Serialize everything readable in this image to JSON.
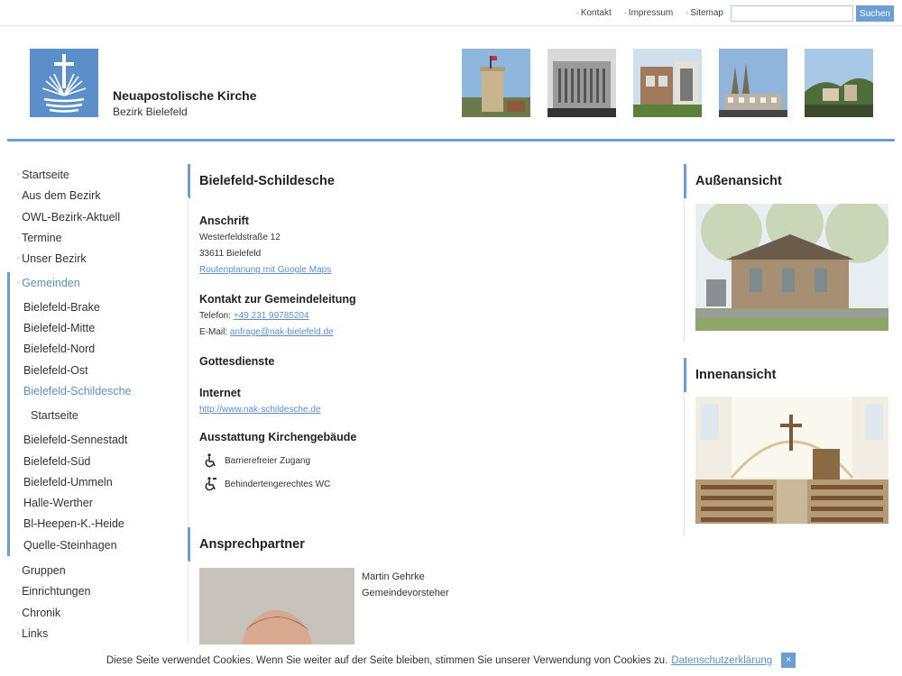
{
  "topbar": {
    "links": [
      "Kontakt",
      "Impressum",
      "Sitemap"
    ],
    "search_value": "",
    "search_button": "Suchen"
  },
  "header": {
    "title": "Neuapostolische Kirche",
    "subtitle": "Bezirk Bielefeld"
  },
  "sidebar": {
    "top_items": [
      "Startseite",
      "Aus dem Bezirk",
      "OWL-Bezirk-Aktuell",
      "Termine",
      "Unser Bezirk"
    ],
    "active_item": "Gemeinden",
    "sub_items_a": [
      "Bielefeld-Brake",
      "Bielefeld-Mitte",
      "Bielefeld-Nord",
      "Bielefeld-Ost"
    ],
    "sub_active": "Bielefeld-Schildesche",
    "subsub_item": "Startseite",
    "sub_items_b": [
      "Bielefeld-Sennestadt",
      "Bielefeld-Süd",
      "Bielefeld-Ummeln",
      "Halle-Werther",
      "Bl-Heepen-K.-Heide",
      "Quelle-Steinhagen"
    ],
    "bottom_items": [
      "Gruppen",
      "Einrichtungen",
      "Chronik",
      "Links"
    ]
  },
  "main": {
    "title": "Bielefeld-Schildesche",
    "address_title": "Anschrift",
    "street": "Westerfeldstraße 12",
    "city": "33611 Bielefeld",
    "route_link": "Routenplanung mit Google Maps",
    "contact_title": "Kontakt zur Gemeindeleitung",
    "phone_label": "Telefon:",
    "phone": "+49 231 99785204",
    "email_label": "E-Mail:",
    "email": "anfrage@nak-bielefeld.de",
    "services_title": "Gottesdienste",
    "internet_title": "Internet",
    "internet_link": "http://www.nak-schildesche.de",
    "equipment_title": "Ausstattung Kirchengebäude",
    "features": [
      "Barrierefreier Zugang",
      "Behindertengerechtes WC"
    ]
  },
  "contact": {
    "title": "Ansprechpartner",
    "name": "Martin Gehrke",
    "role": "Gemeindevorsteher"
  },
  "right": {
    "exterior_title": "Außenansicht",
    "interior_title": "Innenansicht"
  },
  "cookie": {
    "text": "Diese Seite verwendet Cookies. Wenn Sie weiter auf der Seite bleiben, stimmen Sie unserer Verwendung von Cookies zu.",
    "link": "Datenschutzerklärung",
    "close": "×"
  },
  "colors": {
    "accent": "#6c9fd1",
    "link": "#5b8fc9"
  }
}
